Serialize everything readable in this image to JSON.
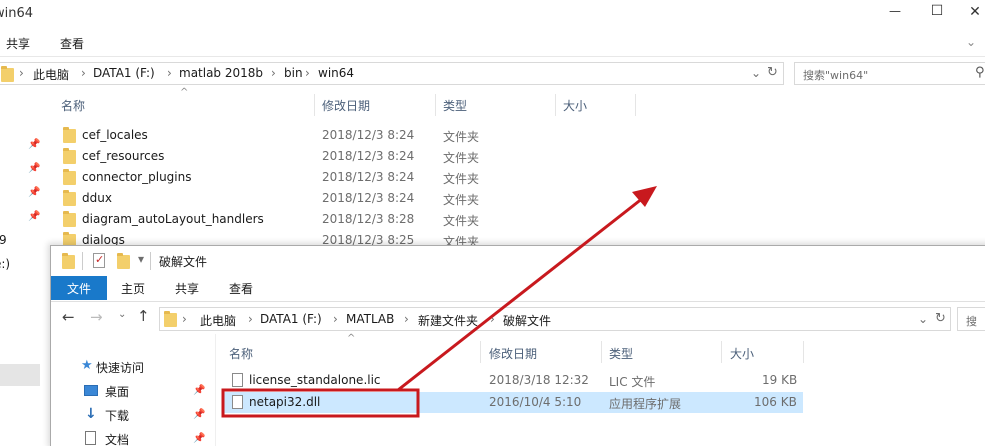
{
  "back_window": {
    "title": "win64",
    "window_controls": {
      "minimize": "—",
      "maximize": "☐",
      "close": "✕"
    },
    "ribbon_tabs": [
      "共享",
      "查看"
    ],
    "breadcrumb": [
      "此电脑",
      "DATA1 (F:)",
      "matlab 2018b",
      "bin",
      "win64"
    ],
    "search_placeholder": "搜索\"win64\"",
    "columns": {
      "name": "名称",
      "date": "修改日期",
      "type": "类型",
      "size": "大小"
    },
    "files": [
      {
        "name": "cef_locales",
        "date": "2018/12/3 8:24",
        "type": "文件夹"
      },
      {
        "name": "cef_resources",
        "date": "2018/12/3 8:24",
        "type": "文件夹"
      },
      {
        "name": "connector_plugins",
        "date": "2018/12/3 8:24",
        "type": "文件夹"
      },
      {
        "name": "ddux",
        "date": "2018/12/3 8:24",
        "type": "文件夹"
      },
      {
        "name": "diagram_autoLayout_handlers",
        "date": "2018/12/3 8:28",
        "type": "文件夹"
      },
      {
        "name": "dialogs",
        "date": "2018/12/3 8:25",
        "type": "文件夹"
      }
    ],
    "left_fragments": [
      "9",
      "e:)"
    ]
  },
  "front_window": {
    "title": "破解文件",
    "qat_dropdown": "▾",
    "ribbon_tabs": [
      {
        "label": "文件",
        "active": true
      },
      {
        "label": "主页",
        "active": false
      },
      {
        "label": "共享",
        "active": false
      },
      {
        "label": "查看",
        "active": false
      }
    ],
    "breadcrumb": [
      "此电脑",
      "DATA1 (F:)",
      "MATLAB",
      "新建文件夹",
      "破解文件"
    ],
    "search_placeholder": "搜",
    "nav": [
      {
        "label": "快速访问",
        "icon": "star-icon"
      },
      {
        "label": "桌面",
        "icon": "desktop-icon"
      },
      {
        "label": "下载",
        "icon": "download-icon"
      },
      {
        "label": "文档",
        "icon": "document-icon"
      }
    ],
    "columns": {
      "name": "名称",
      "date": "修改日期",
      "type": "类型",
      "size": "大小"
    },
    "files": [
      {
        "name": "license_standalone.lic",
        "date": "2018/3/18 12:32",
        "type": "LIC 文件",
        "size": "19 KB",
        "selected": false
      },
      {
        "name": "netapi32.dll",
        "date": "2016/10/4 5:10",
        "type": "应用程序扩展",
        "size": "106 KB",
        "selected": true
      }
    ]
  },
  "annotation": {
    "color": "#c8191e"
  },
  "colors": {
    "accent": "#1979ca",
    "selection": "#cce8ff",
    "folder": "#f3cf6b"
  }
}
